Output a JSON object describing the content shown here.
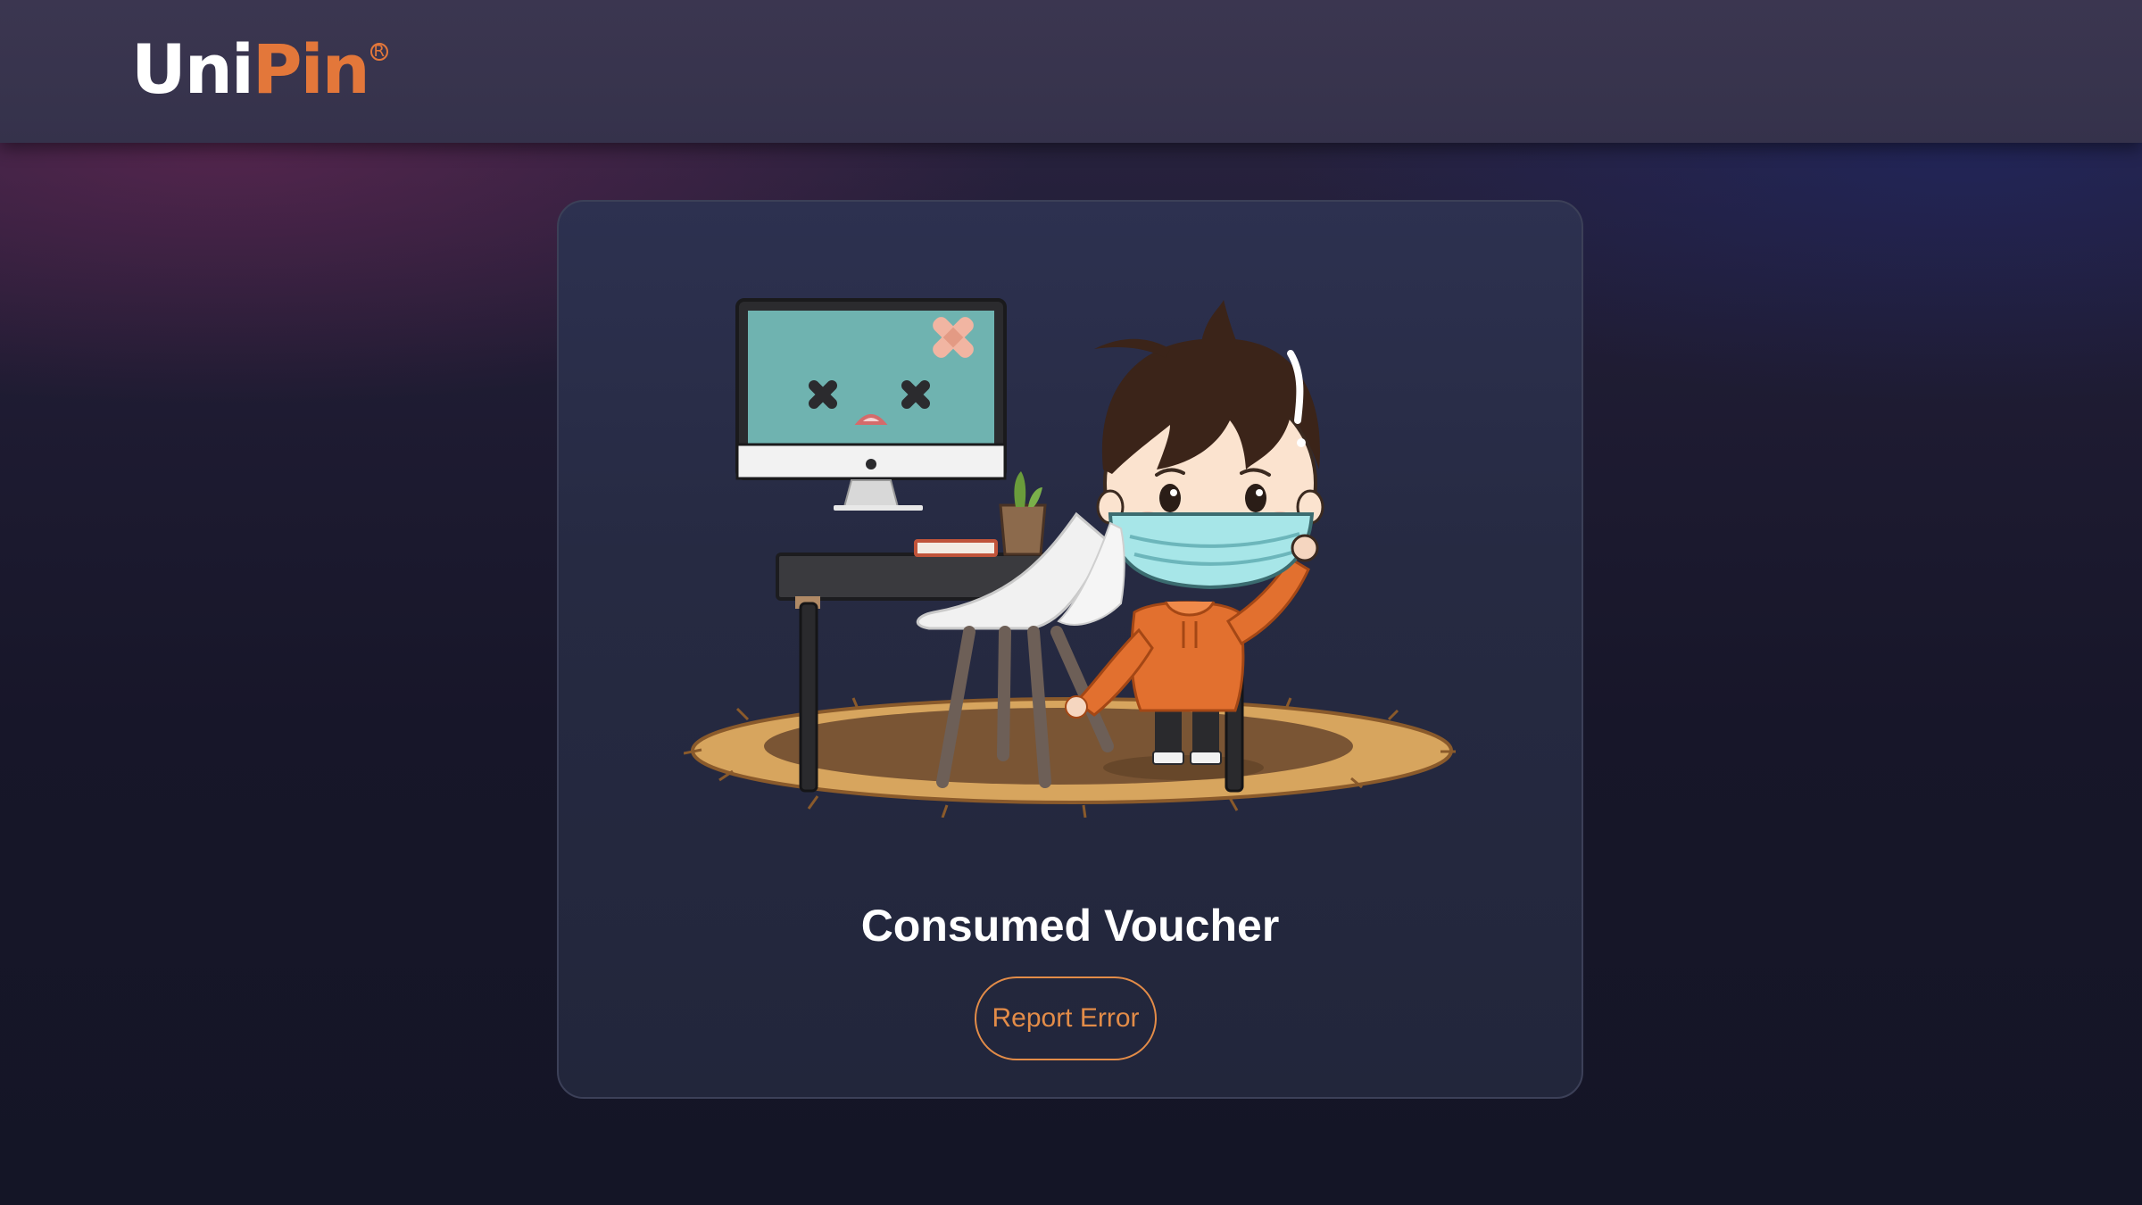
{
  "header": {
    "logo_text_uni": "Uni",
    "logo_text_pin": "Pin",
    "logo_registered_mark": "R"
  },
  "error_card": {
    "illustration_icon": "broken-computer-masked-boy-illustration",
    "title": "Consumed Voucher",
    "report_button_label": "Report Error"
  },
  "colors": {
    "brand_accent": "#e3773a",
    "button_outline": "#e38c48",
    "card_background": "#272b44",
    "page_background": "#171629"
  }
}
